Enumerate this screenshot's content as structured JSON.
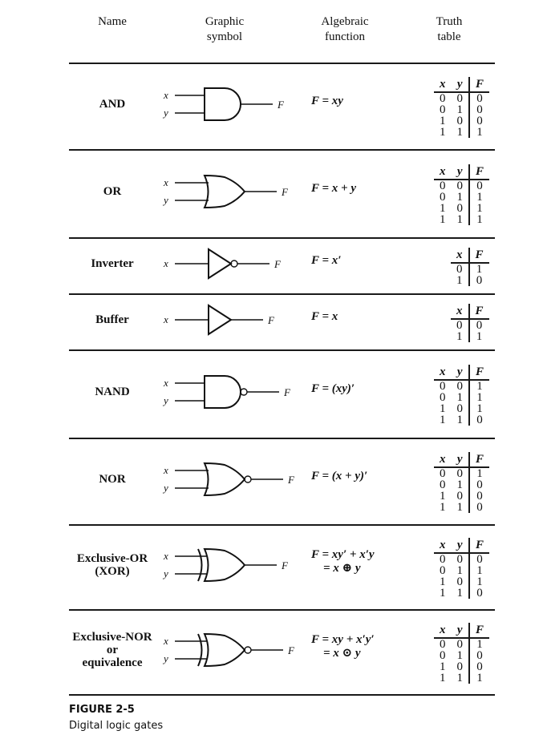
{
  "headers": {
    "name": "Name",
    "symbol": "Graphic\nsymbol",
    "function": "Algebraic\nfunction",
    "truth": "Truth\ntable"
  },
  "gates": [
    {
      "id": "and",
      "name": "AND",
      "symbol": "and-gate-icon",
      "inputs": [
        "x",
        "y"
      ],
      "output": "F",
      "function": "F = xy",
      "truth": {
        "cols": [
          "x",
          "y",
          "F"
        ],
        "rows": [
          [
            "0",
            "0",
            "0"
          ],
          [
            "0",
            "1",
            "0"
          ],
          [
            "1",
            "0",
            "0"
          ],
          [
            "1",
            "1",
            "1"
          ]
        ]
      }
    },
    {
      "id": "or",
      "name": "OR",
      "symbol": "or-gate-icon",
      "inputs": [
        "x",
        "y"
      ],
      "output": "F",
      "function": "F = x + y",
      "truth": {
        "cols": [
          "x",
          "y",
          "F"
        ],
        "rows": [
          [
            "0",
            "0",
            "0"
          ],
          [
            "0",
            "1",
            "1"
          ],
          [
            "1",
            "0",
            "1"
          ],
          [
            "1",
            "1",
            "1"
          ]
        ]
      }
    },
    {
      "id": "inverter",
      "name": "Inverter",
      "symbol": "inverter-gate-icon",
      "inputs": [
        "x"
      ],
      "output": "F",
      "function": "F = x′",
      "truth": {
        "cols": [
          "x",
          "F"
        ],
        "rows": [
          [
            "0",
            "1"
          ],
          [
            "1",
            "0"
          ]
        ]
      }
    },
    {
      "id": "buffer",
      "name": "Buffer",
      "symbol": "buffer-gate-icon",
      "inputs": [
        "x"
      ],
      "output": "F",
      "function": "F = x",
      "truth": {
        "cols": [
          "x",
          "F"
        ],
        "rows": [
          [
            "0",
            "0"
          ],
          [
            "1",
            "1"
          ]
        ]
      }
    },
    {
      "id": "nand",
      "name": "NAND",
      "symbol": "nand-gate-icon",
      "inputs": [
        "x",
        "y"
      ],
      "output": "F",
      "function": "F = (xy)′",
      "truth": {
        "cols": [
          "x",
          "y",
          "F"
        ],
        "rows": [
          [
            "0",
            "0",
            "1"
          ],
          [
            "0",
            "1",
            "1"
          ],
          [
            "1",
            "0",
            "1"
          ],
          [
            "1",
            "1",
            "0"
          ]
        ]
      }
    },
    {
      "id": "nor",
      "name": "NOR",
      "symbol": "nor-gate-icon",
      "inputs": [
        "x",
        "y"
      ],
      "output": "F",
      "function": "F = (x + y)′",
      "truth": {
        "cols": [
          "x",
          "y",
          "F"
        ],
        "rows": [
          [
            "0",
            "0",
            "1"
          ],
          [
            "0",
            "1",
            "0"
          ],
          [
            "1",
            "0",
            "0"
          ],
          [
            "1",
            "1",
            "0"
          ]
        ]
      }
    },
    {
      "id": "xor",
      "name": "Exclusive-OR\n(XOR)",
      "symbol": "xor-gate-icon",
      "inputs": [
        "x",
        "y"
      ],
      "output": "F",
      "function": "F = xy′ + x′y\n    = x ⊕ y",
      "truth": {
        "cols": [
          "x",
          "y",
          "F"
        ],
        "rows": [
          [
            "0",
            "0",
            "0"
          ],
          [
            "0",
            "1",
            "1"
          ],
          [
            "1",
            "0",
            "1"
          ],
          [
            "1",
            "1",
            "0"
          ]
        ]
      }
    },
    {
      "id": "xnor",
      "name": "Exclusive-NOR\nor\nequivalence",
      "symbol": "xnor-gate-icon",
      "inputs": [
        "x",
        "y"
      ],
      "output": "F",
      "function": "F = xy + x′y′\n    = x ⊙ y",
      "truth": {
        "cols": [
          "x",
          "y",
          "F"
        ],
        "rows": [
          [
            "0",
            "0",
            "1"
          ],
          [
            "0",
            "1",
            "0"
          ],
          [
            "1",
            "0",
            "0"
          ],
          [
            "1",
            "1",
            "1"
          ]
        ]
      }
    }
  ],
  "caption": {
    "title": "FIGURE 2-5",
    "subtitle": "Digital logic gates"
  }
}
